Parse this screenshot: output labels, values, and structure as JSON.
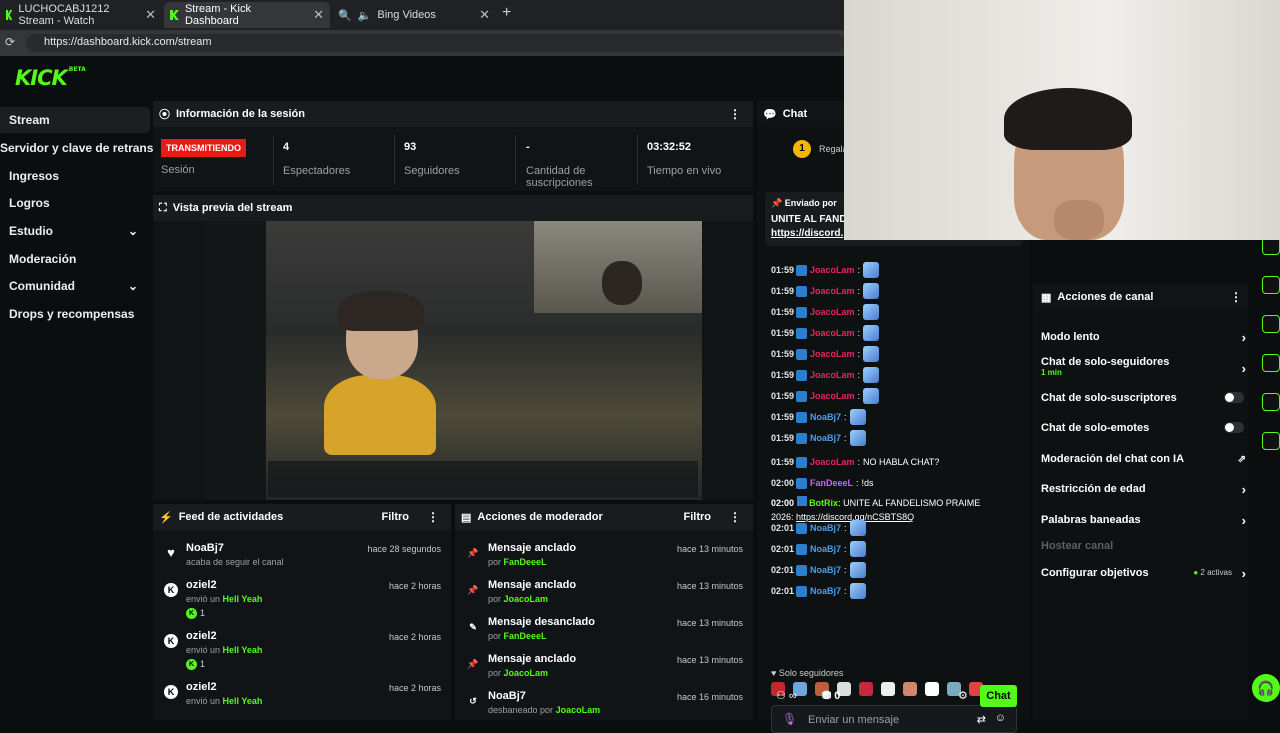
{
  "tabs": [
    {
      "label": "LUCHOCABJ1212 Stream - Watch",
      "close": "✕"
    },
    {
      "label": "Stream - Kick Dashboard",
      "close": "✕"
    },
    {
      "label": "Bing Videos",
      "close": "✕"
    }
  ],
  "new_tab": "+",
  "url": "https://dashboard.kick.com/stream",
  "logo": "KICK",
  "logo_badge": "BETA",
  "nav": [
    "Stream",
    "Servidor y clave de retransmisión",
    "Ingresos",
    "Logros",
    "Estudio",
    "Moderación",
    "Comunidad",
    "Drops y recompensas"
  ],
  "session": {
    "title": "Información de la sesión",
    "status": "TRANSMITIENDO",
    "status_label": "Sesión",
    "stats": [
      {
        "value": "4",
        "label": "Espectadores"
      },
      {
        "value": "93",
        "label": "Seguidores"
      },
      {
        "value": "-",
        "label": "Cantidad de suscripciones"
      },
      {
        "value": "03:32:52",
        "label": "Tiempo en vivo"
      }
    ]
  },
  "preview_title": "Vista previa del stream",
  "feed": {
    "title": "Feed de actividades",
    "filter": "Filtro",
    "items": [
      {
        "name": "NoaBj7",
        "sub": "acaba de seguir el canal",
        "time": "hace 28 segundos",
        "icon": "heart-icon"
      },
      {
        "name": "oziel2",
        "sub_pre": "envió un",
        "sub_item": "Hell Yeah",
        "count": "1",
        "time": "hace 2 horas",
        "icon": "kick-icon"
      },
      {
        "name": "oziel2",
        "sub_pre": "envió un",
        "sub_item": "Hell Yeah",
        "count": "1",
        "time": "hace 2 horas",
        "icon": "kick-icon"
      },
      {
        "name": "oziel2",
        "sub_pre": "envió un",
        "sub_item": "Hell Yeah",
        "time": "hace 2 horas",
        "icon": "kick-icon"
      }
    ]
  },
  "mod": {
    "title": "Acciones de moderador",
    "filter": "Filtro",
    "items": [
      {
        "action": "Mensaje anclado",
        "pre": "por",
        "by": "FanDeeeL",
        "time": "hace 13 minutos",
        "icon": "pin-icon"
      },
      {
        "action": "Mensaje anclado",
        "pre": "por",
        "by": "JoacoLam",
        "time": "hace 13 minutos",
        "icon": "pin-icon"
      },
      {
        "action": "Mensaje desanclado",
        "pre": "por",
        "by": "FanDeeeL",
        "time": "hace 13 minutos",
        "icon": "unpin-icon"
      },
      {
        "action": "Mensaje anclado",
        "pre": "por",
        "by": "JoacoLam",
        "time": "hace 13 minutos",
        "icon": "pin-icon"
      },
      {
        "action": "NoaBj7",
        "pre": "desbaneado por",
        "by": "JoacoLam",
        "time": "hace 16 minutos",
        "icon": "undo-icon"
      }
    ]
  },
  "chat": {
    "title": "Chat",
    "gift_rank": "1",
    "gift_label": "Regala",
    "pinned": {
      "label": "Enviado por",
      "text": "UNITE AL FANDE",
      "link": "https://discord."
    },
    "lines": [
      {
        "time": "01:59",
        "user": "JoacoLam",
        "color": "#e5275f",
        "msg": ""
      },
      {
        "time": "01:59",
        "user": "JoacoLam",
        "color": "#e5275f",
        "msg": ""
      },
      {
        "time": "01:59",
        "user": "JoacoLam",
        "color": "#e5275f",
        "msg": ""
      },
      {
        "time": "01:59",
        "user": "JoacoLam",
        "color": "#e5275f",
        "msg": ""
      },
      {
        "time": "01:59",
        "user": "JoacoLam",
        "color": "#e5275f",
        "msg": ""
      },
      {
        "time": "01:59",
        "user": "JoacoLam",
        "color": "#e5275f",
        "msg": ""
      },
      {
        "time": "01:59",
        "user": "JoacoLam",
        "color": "#e5275f",
        "msg": ""
      },
      {
        "time": "01:59",
        "user": "NoaBj7",
        "color": "#4c9fe8",
        "msg": ""
      },
      {
        "time": "01:59",
        "user": "NoaBj7",
        "color": "#4c9fe8",
        "msg": ""
      },
      {
        "time": "01:59",
        "user": "JoacoLam",
        "color": "#e5275f",
        "msg": "NO HABLA CHAT?"
      },
      {
        "time": "02:00",
        "user": "FanDeeeL",
        "color": "#c26bf0",
        "msg": "!ds"
      }
    ],
    "bot": {
      "time": "02:00",
      "user": "BotRix",
      "msg": "UNITE AL FANDELISMO PRAIME",
      "msg2": "2026:",
      "link": "https://discord.gg/nCSBTS8Q"
    },
    "lines2": [
      {
        "time": "02:01",
        "user": "NoaBj7",
        "color": "#4c9fe8"
      },
      {
        "time": "02:01",
        "user": "NoaBj7",
        "color": "#4c9fe8"
      },
      {
        "time": "02:01",
        "user": "NoaBj7",
        "color": "#4c9fe8"
      },
      {
        "time": "02:01",
        "user": "NoaBj7",
        "color": "#4c9fe8"
      }
    ],
    "mode": "Solo seguidores",
    "placeholder": "Enviar un mensaje",
    "points": "0",
    "send": "Chat"
  },
  "actions": {
    "title": "Acciones de canal",
    "items": [
      {
        "label": "Modo lento",
        "type": "arrow"
      },
      {
        "label": "Chat de solo-seguidores",
        "sub": "1 min",
        "type": "arrow"
      },
      {
        "label": "Chat de solo-suscriptores",
        "type": "toggle"
      },
      {
        "label": "Chat de solo-emotes",
        "type": "toggle"
      },
      {
        "label": "Moderación del chat con IA",
        "type": "external"
      },
      {
        "label": "Restricción de edad",
        "type": "arrow"
      },
      {
        "label": "Palabras baneadas",
        "type": "arrow"
      },
      {
        "label": "Hostear canal",
        "type": "disabled"
      },
      {
        "label": "Configurar objetivos",
        "sub": "2 activas",
        "type": "arrow"
      }
    ]
  }
}
